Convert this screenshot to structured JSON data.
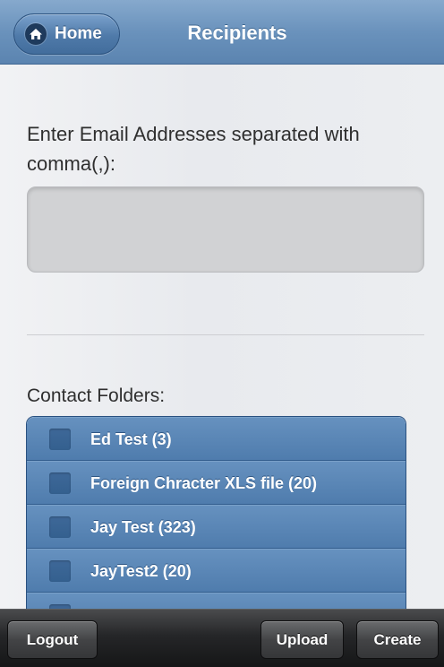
{
  "header": {
    "home_label": "Home",
    "title": "Recipients"
  },
  "email": {
    "instruction": "Enter Email Addresses separated with comma(,):",
    "value": ""
  },
  "folders": {
    "label": "Contact Folders:",
    "items": [
      {
        "label": "Ed Test (3)"
      },
      {
        "label": "Foreign Chracter XLS file (20)"
      },
      {
        "label": "Jay Test (323)"
      },
      {
        "label": "JayTest2 (20)"
      },
      {
        "label": ""
      }
    ]
  },
  "toolbar": {
    "logout_label": "Logout",
    "upload_label": "Upload",
    "create_label": "Create"
  }
}
